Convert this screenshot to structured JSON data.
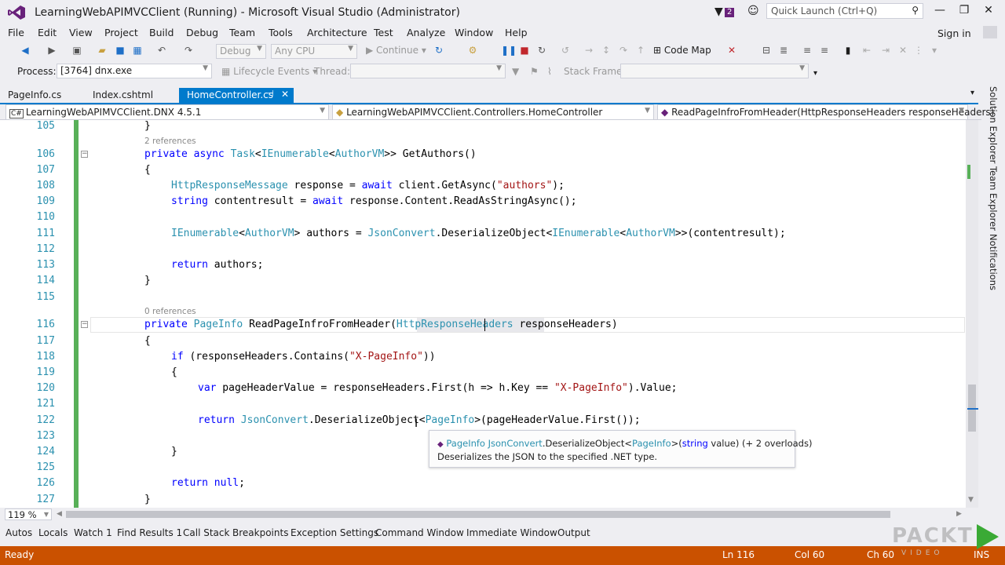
{
  "window": {
    "title": "LearningWebAPIMVCClient (Running) - Microsoft Visual Studio (Administrator)",
    "notification_count": "2",
    "quick_launch_placeholder": "Quick Launch (Ctrl+Q)",
    "sign_in": "Sign in"
  },
  "menu": [
    "File",
    "Edit",
    "View",
    "Project",
    "Build",
    "Debug",
    "Team",
    "Tools",
    "Architecture",
    "Test",
    "Analyze",
    "Window",
    "Help"
  ],
  "toolbar": {
    "config": "Debug",
    "platform": "Any CPU",
    "continue": "Continue",
    "code_map": "Code Map"
  },
  "debug_location": {
    "process_label": "Process:",
    "process_value": "[3764] dnx.exe",
    "lifecycle": "Lifecycle Events",
    "thread_label": "Thread:",
    "stack_frame_label": "Stack Frame:"
  },
  "tabs": [
    "PageInfo.cs",
    "Index.cshtml",
    "HomeController.cs"
  ],
  "navbar": {
    "project": "LearningWebAPIMVCClient.DNX 4.5.1",
    "class": "LearningWebAPIMVCClient.Controllers.HomeController",
    "member": "ReadPageInfroFromHeader(HttpResponseHeaders responseHeaders)"
  },
  "code": {
    "refs_106": "2 references",
    "refs_116": "0 references",
    "line_numbers": [
      "105",
      "106",
      "107",
      "108",
      "109",
      "110",
      "111",
      "112",
      "113",
      "114",
      "115",
      "116",
      "117",
      "118",
      "119",
      "120",
      "121",
      "122",
      "123",
      "124",
      "125",
      "126",
      "127"
    ]
  },
  "tooltip": {
    "sig_type": "PageInfo",
    "sig_class": "JsonConvert",
    "sig_method": ".DeserializeObject<",
    "sig_generic": "PageInfo",
    "sig_rest_1": ">(",
    "sig_kw": "string",
    "sig_rest_2": " value) (+ 2 overloads)",
    "description": "Deserializes the JSON to the specified .NET type."
  },
  "zoom": "119 %",
  "side_panels": [
    "Solution Explorer",
    "Team Explorer",
    "Notifications"
  ],
  "bottom_tabs": [
    "Autos",
    "Locals",
    "Watch 1",
    "Find Results 1",
    "Call Stack",
    "Breakpoints",
    "Exception Settings",
    "Command Window",
    "Immediate Window",
    "Output"
  ],
  "status": {
    "ready": "Ready",
    "line": "Ln 116",
    "col": "Col 60",
    "ch": "Ch 60",
    "mode": "INS"
  },
  "watermark": {
    "brand": "PACKT",
    "sub": "VIDEO"
  },
  "colors": {
    "accent": "#007acc",
    "status_bar": "#ca5100",
    "keyword": "#0000ff",
    "type": "#2b91af",
    "string": "#a31515",
    "line_number": "#2b91af"
  }
}
